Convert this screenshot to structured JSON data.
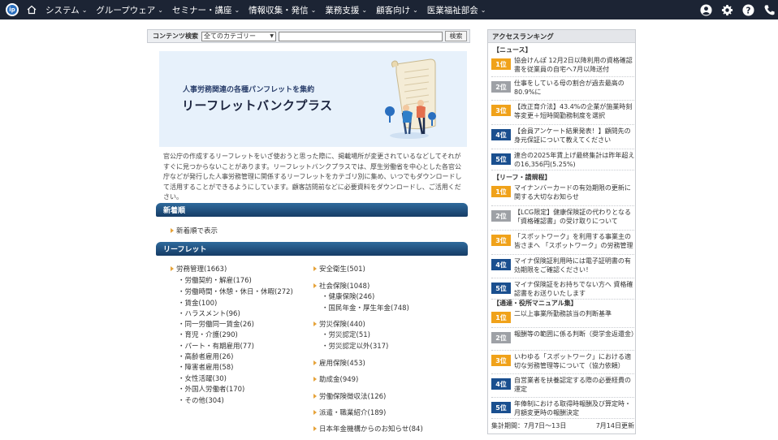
{
  "nav": {
    "logo_text": "ip",
    "items": [
      "システム",
      "グループウェア",
      "セミナー・講座",
      "情報収集・発信",
      "業務支援",
      "顧客向け",
      "医業福祉部会"
    ]
  },
  "search": {
    "label": "コンテンツ検索",
    "select_value": "全てのカテゴリー",
    "input_value": "",
    "button": "検索"
  },
  "banner": {
    "subtitle": "人事労務関連の各種パンフレットを集約",
    "title": "リーフレットバンクプラス"
  },
  "intro": "官公庁の作成するリーフレットをいざ使おうと思った際に、掲載場所が変更されているなどしてそれがすぐに見つからないことがあります。リーフレットバンクプラスでは、厚生労働省を中心とした各官公庁などが発行した人事労務管理に関係するリーフレットをカテゴリ別に集め、いつでもダウンロードして活用することができるようにしています。顧客訪問前などに必要資料をダウンロードし、ご活用ください。",
  "new_section": {
    "title": "新着順",
    "link": "新着順で表示"
  },
  "leaflet_section": {
    "title": "リーフレット"
  },
  "left_categories": {
    "main": "労務管理(1663)",
    "subs": [
      "・労働契約・解雇(176)",
      "・労働時間・休憩・休日・休暇(272)",
      "・賃金(100)",
      "・ハラスメント(96)",
      "・同一労働同一賃金(26)",
      "・育児・介護(290)",
      "・パート・有期雇用(77)",
      "・高齢者雇用(26)",
      "・障害者雇用(58)",
      "・女性活躍(30)",
      "・外国人労働者(170)",
      "・その他(304)"
    ]
  },
  "right_categories": {
    "safety": "安全衛生(501)",
    "social": "社会保険(1048)",
    "social_subs": [
      "・健康保険(246)",
      "・国民年金・厚生年金(748)"
    ],
    "workers": "労災保険(440)",
    "workers_subs": [
      "・労災認定(51)",
      "・労災認定以外(317)"
    ],
    "employment": "雇用保険(453)",
    "subsidy": "助成金(949)",
    "collection": "労働保険徴収法(126)",
    "dispatch": "派遣・職業紹介(189)",
    "pension": "日本年金機構からのお知らせ(84)"
  },
  "ranking": {
    "title": "アクセスランキング",
    "categories": [
      "【ニュース】",
      "【リーフ・請規程】",
      "【通達・役所マニュアル集】"
    ],
    "badges": [
      "1位",
      "2位",
      "3位",
      "4位",
      "5位"
    ],
    "badge_colors": [
      "#f0a21a",
      "#9ea1a6",
      "#f0a21a",
      "#1a4f8f",
      "#1a4f8f"
    ],
    "news": [
      "協会けんぽ 12月2日以降利用の資格確認書を従業員の自宅へ7月以降送付",
      "仕事をしている母の割合が過去最高の80.9%に",
      "【改正育介法】43.4%の企業が施業時刻等変更＋短時間勤務制度を選択",
      "【会員アンケート結果発表！】顧問先の身元保証について教えてください",
      "連合の2025年賃上げ最終集計は昨年超えの16,356円(5.25%)"
    ],
    "leaflets": [
      "マイナンバーカードの有効期限の更新に関する大切なお知らせ",
      "【LCG限定】健康保険証の代わりとなる「資格確認書」の受け取りについて",
      "「スポットワーク」を利用する事業主の皆さまへ 「スポットワーク」の労務管理",
      "マイナ保険証利用時には電子証明書の有効期限をご確認ください！",
      "マイナ保険証をお持ちでない方へ 資格確認書をお送りいたします"
    ],
    "notices": [
      "二以上事業所勤務該当の判断基準",
      "報酬等の範囲に係る判断（奨学金返還金）",
      "いわゆる「スポットワーク」における適切な労務管理等について（協力依頼）",
      "自営業者を扶養認定する際の必要経費の運定",
      "年俸制における取得時報酬及び算定時・月額変更時の報酬決定"
    ],
    "footer_left": "集計期間：7月7日〜13日",
    "footer_right": "7月14日更新"
  }
}
